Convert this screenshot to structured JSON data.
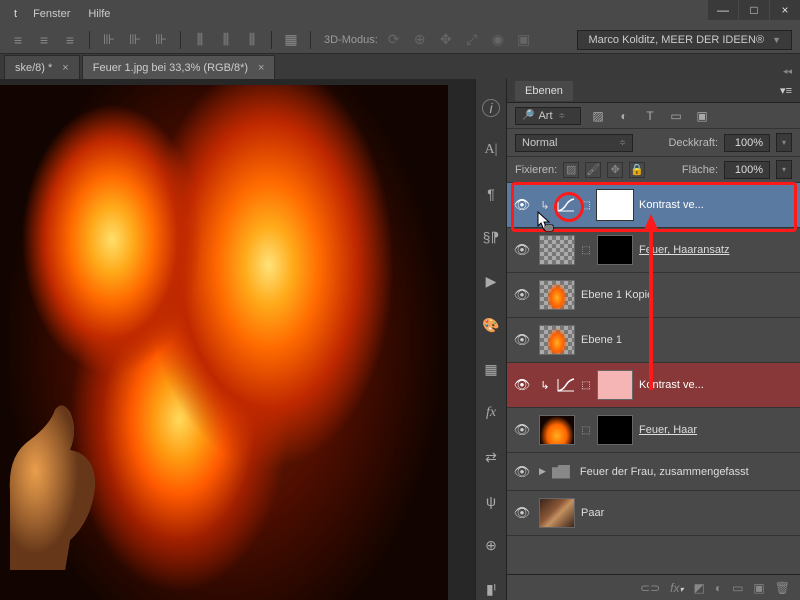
{
  "window_buttons": {
    "min": "—",
    "max": "□",
    "close": "×"
  },
  "menu": {
    "fenster": "Fenster",
    "hilfe": "Hilfe"
  },
  "toolbar": {
    "mode_label": "3D-Modus:"
  },
  "user_label": "Marco Kolditz, MEER DER IDEEN®",
  "tabs": [
    {
      "label": "ske/8) *",
      "active": false
    },
    {
      "label": "Feuer 1.jpg bei 33,3% (RGB/8*)",
      "active": true
    }
  ],
  "panel": {
    "title": "Ebenen",
    "filter_label": "Art",
    "blend_mode": "Normal",
    "opacity_label": "Deckkraft:",
    "opacity_value": "100%",
    "lock_label": "Fixieren:",
    "fill_label": "Fläche:",
    "fill_value": "100%"
  },
  "layers": [
    {
      "name": "Kontrast ve...",
      "type": "adjustment",
      "selected": true,
      "mask": "white"
    },
    {
      "name": "Feuer, Haaransatz",
      "type": "image",
      "checker": true,
      "mask": "black",
      "underline": true
    },
    {
      "name": "Ebene 1 Kopie",
      "type": "image",
      "checker": true,
      "flame": true
    },
    {
      "name": "Ebene 1",
      "type": "image",
      "checker": true,
      "flame": true
    },
    {
      "name": "Kontrast ve...",
      "type": "adjustment",
      "red": true,
      "mask": "pink"
    },
    {
      "name": "Feuer, Haar",
      "type": "image",
      "flame_full": true,
      "mask": "black",
      "underline": true
    },
    {
      "name": "Feuer der Frau, zusammengefasst",
      "type": "group"
    },
    {
      "name": "Paar",
      "type": "image",
      "paar": true
    }
  ],
  "icons": {
    "search": "🔍",
    "eye": "👁",
    "link": "⬚",
    "menu": "≡",
    "fx": "fx.",
    "mask": "□",
    "adj": "◐",
    "folder": "▢",
    "new": "▣",
    "trash": "🗑"
  }
}
